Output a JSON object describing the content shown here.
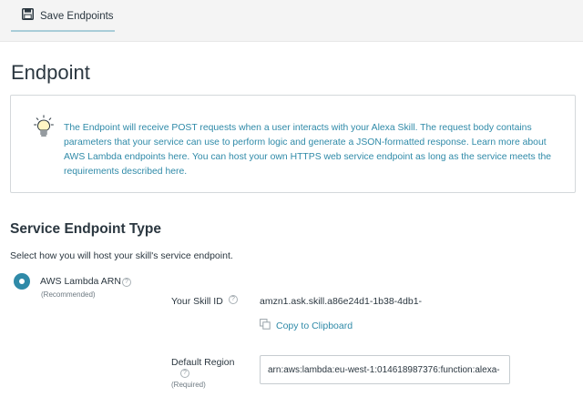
{
  "toolbar": {
    "save_label": "Save Endpoints",
    "save_icon": "floppy-disk-icon"
  },
  "page": {
    "title": "Endpoint"
  },
  "info": {
    "icon": "lightbulb-icon",
    "text_1": "The Endpoint will receive POST requests when a user interacts with your Alexa Skill. The request body contains parameters that your service can use to perform logic and generate a JSON-formatted response. Learn more about AWS Lambda endpoints ",
    "link_1": "here",
    "text_2": ". You can host your own HTTPS web service endpoint as long as the service meets the requirements described ",
    "link_2": "here",
    "text_3": "."
  },
  "service_endpoint": {
    "title": "Service Endpoint Type",
    "subtitle": "Select how you will host your skill's service endpoint.",
    "option_label": "AWS Lambda ARN",
    "option_note": "(Recommended)",
    "option_selected": true,
    "help_glyph": "?",
    "skill_id_label": "Your Skill ID",
    "skill_id_value": "amzn1.ask.skill.a86e24d1-1b38-4db1-",
    "copy_label": "Copy to Clipboard",
    "copy_icon": "copy-icon",
    "region_label": "Default Region",
    "region_required": "(Required)",
    "region_value": "arn:aws:lambda:eu-west-1:014618987376:function:alexa-"
  },
  "colors": {
    "accent": "#2f8aa8",
    "text": "#2b3740",
    "toolbar_bg": "#f4f4f4"
  }
}
